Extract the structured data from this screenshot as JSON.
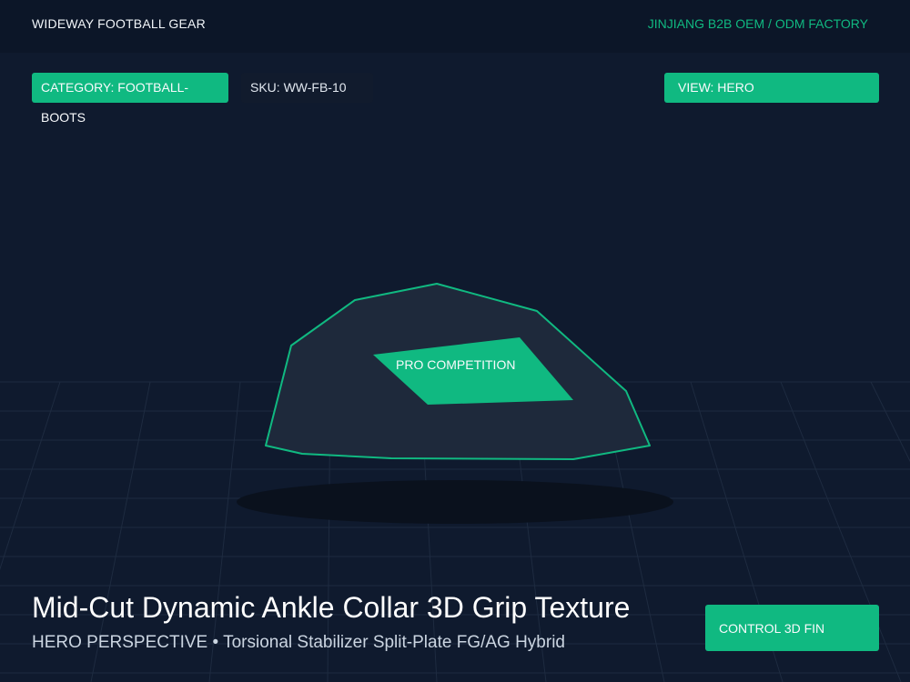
{
  "header": {
    "brand": "WIDEWAY FOOTBALL GEAR",
    "factory": "JINJIANG B2B OEM / ODM FACTORY"
  },
  "chips": {
    "category": "CATEGORY: FOOTBALL-BOOTS",
    "sku": "SKU: WW-FB-10",
    "view": "VIEW: HERO"
  },
  "model": {
    "badge": "PRO COMPETITION"
  },
  "product": {
    "title": "Mid-Cut Dynamic Ankle Collar 3D Grip Texture",
    "subtitle": "HERO PERSPECTIVE • Torsional Stabilizer Split-Plate FG/AG Hybrid"
  },
  "controls": {
    "button_label": "CONTROL 3D FIN"
  },
  "colors": {
    "accent": "#10b981",
    "background": "#0f1a2e",
    "header": "#0c1628",
    "model_fill": "#1e293b"
  }
}
